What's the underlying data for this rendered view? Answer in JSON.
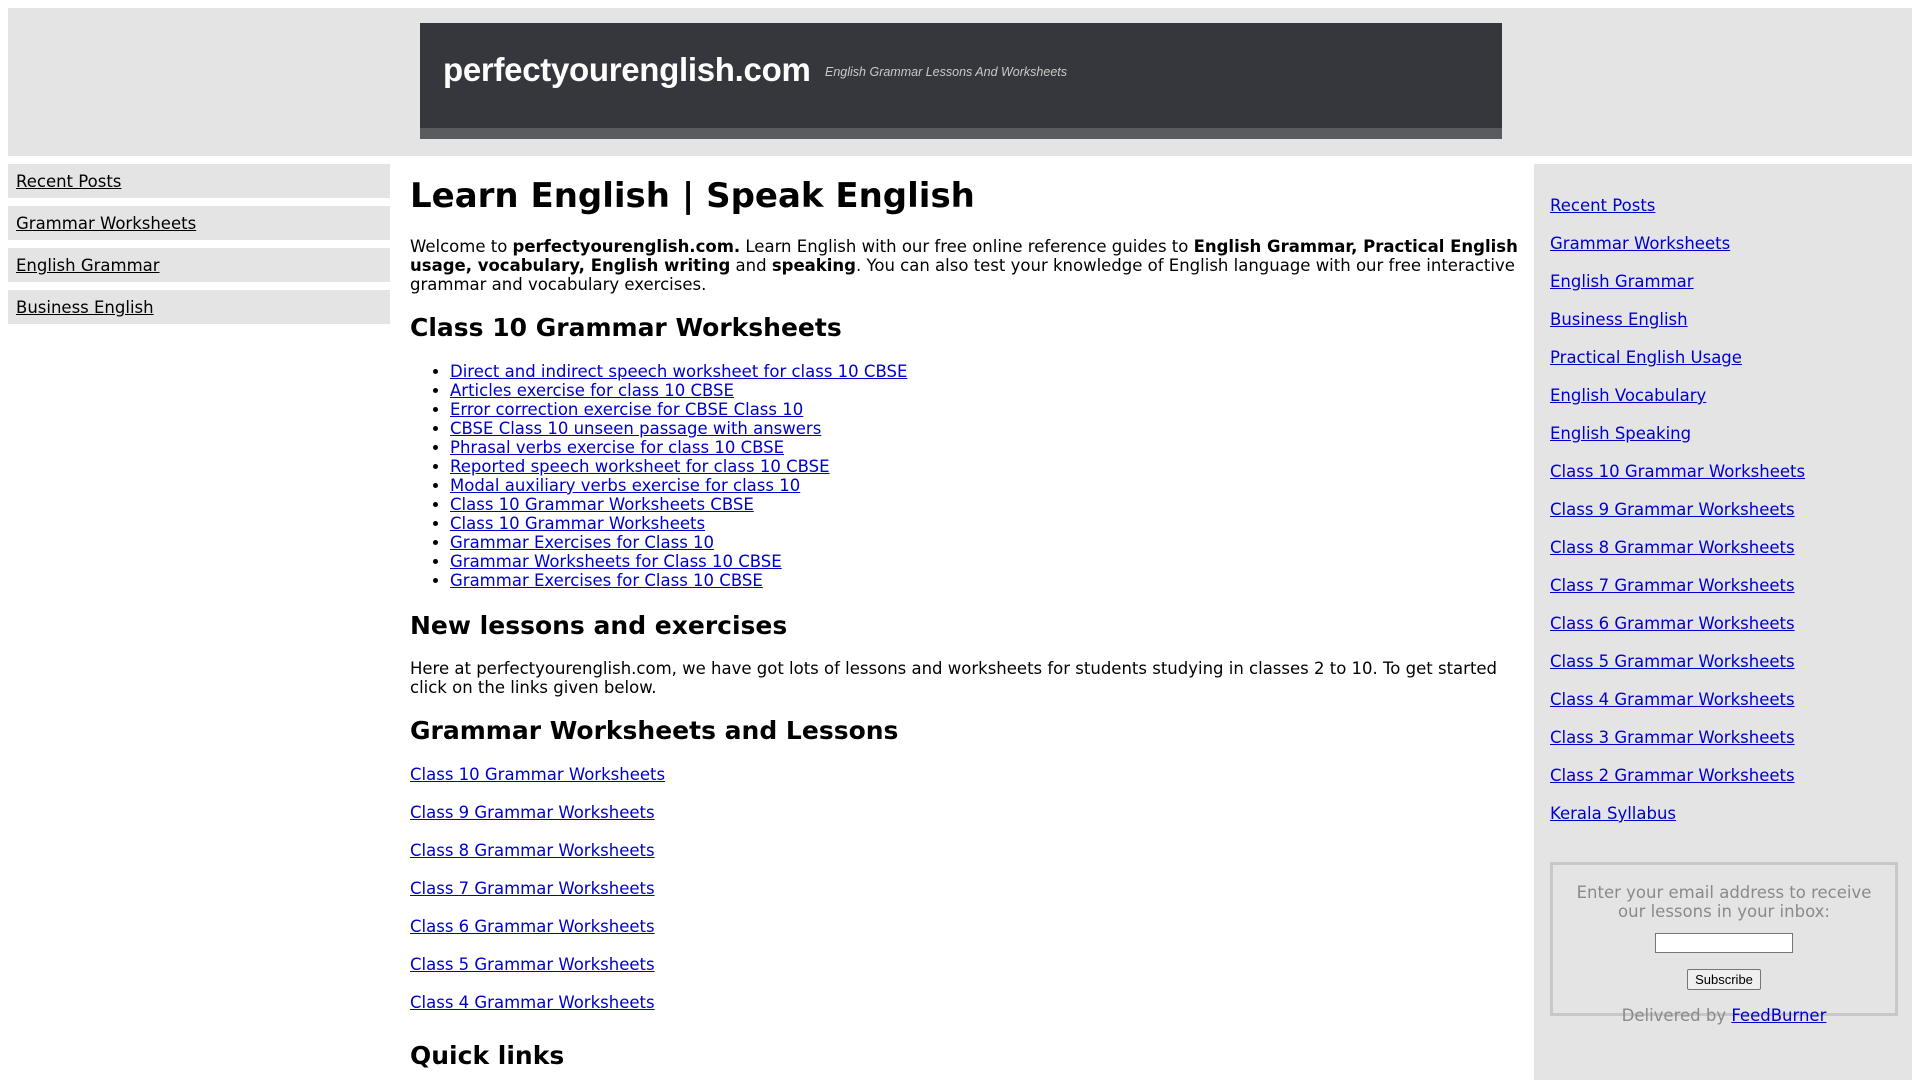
{
  "banner": {
    "site_title": "perfectyourenglish.com",
    "tagline": "English Grammar Lessons And Worksheets"
  },
  "left_nav": {
    "items": [
      "Recent Posts",
      "Grammar Worksheets",
      "English Grammar",
      "Business English"
    ]
  },
  "main": {
    "title": "Learn English | Speak English",
    "intro": {
      "welcome": "Welcome to ",
      "site_name": "perfectyourenglish.com.",
      "text1": " Learn English with our free online reference guides to ",
      "bold1": "English Grammar, Practical English usage, vocabulary, English writing",
      "text2": " and ",
      "bold2": "speaking",
      "text3": ". You can also test your knowledge of English language with our free interactive grammar and vocabulary exercises."
    },
    "class10_heading": "Class 10 Grammar Worksheets",
    "class10_links": [
      "Direct and indirect speech worksheet for class 10 CBSE",
      "Articles exercise for class 10 CBSE",
      "Error correction exercise for CBSE Class 10",
      "CBSE Class 10 unseen passage with answers",
      "Phrasal verbs exercise for class 10 CBSE",
      "Reported speech worksheet for class 10 CBSE",
      "Modal auxiliary verbs exercise for class 10",
      "Class 10 Grammar Worksheets CBSE",
      "Class 10 Grammar Worksheets",
      "Grammar Exercises for Class 10",
      "Grammar Worksheets for Class 10 CBSE",
      "Grammar Exercises for Class 10 CBSE"
    ],
    "new_heading": "New lessons and exercises",
    "new_text": "Here at perfectyourenglish.com, we have got lots of lessons and worksheets for students studying in classes 2 to 10. To get started click on the links given below.",
    "worksheets_heading": "Grammar Worksheets and Lessons",
    "worksheet_links": [
      "Class 10 Grammar Worksheets",
      "Class 9 Grammar Worksheets",
      "Class 8 Grammar Worksheets",
      "Class 7 Grammar Worksheets",
      "Class 6 Grammar Worksheets",
      "Class 5 Grammar Worksheets",
      "Class 4 Grammar Worksheets"
    ],
    "quick_heading": "Quick links"
  },
  "right_sidebar": {
    "links": [
      "Recent Posts",
      "Grammar Worksheets",
      "English Grammar",
      "Business English",
      "Practical English Usage",
      "English Vocabulary",
      "English Speaking",
      "Class 10 Grammar Worksheets",
      "Class 9 Grammar Worksheets",
      "Class 8 Grammar Worksheets",
      "Class 7 Grammar Worksheets",
      "Class 6 Grammar Worksheets",
      "Class 5 Grammar Worksheets",
      "Class 4 Grammar Worksheets",
      "Class 3 Grammar Worksheets",
      "Class 2 Grammar Worksheets",
      "Kerala Syllabus"
    ],
    "subscribe": {
      "prompt": "Enter your email address to receive our lessons in your inbox:",
      "email_value": "",
      "button": "Subscribe",
      "delivered_by": "Delivered by ",
      "feedburner": "FeedBurner"
    }
  },
  "colors": {
    "banner_bg": "#35373c",
    "panel_bg": "#e4e4e4",
    "link": "#0000cc"
  }
}
